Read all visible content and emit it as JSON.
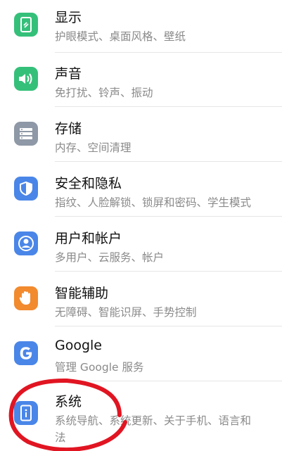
{
  "colors": {
    "green": "#35c07a",
    "gray": "#8e98a6",
    "blue": "#4a86e8",
    "orange": "#f28a2e",
    "annotation_red": "#e11522"
  },
  "settings": {
    "items": [
      {
        "title": "显示",
        "subtitle": "护眼模式、桌面风格、壁纸",
        "icon": "display-icon"
      },
      {
        "title": "声音",
        "subtitle": "免打扰、铃声、振动",
        "icon": "sound-icon"
      },
      {
        "title": "存储",
        "subtitle": "内存、空间清理",
        "icon": "storage-icon"
      },
      {
        "title": "安全和隐私",
        "subtitle": "指纹、人脸解锁、锁屏和密码、学生模式",
        "icon": "security-shield-icon"
      },
      {
        "title": "用户和帐户",
        "subtitle": "多用户、云服务、帐户",
        "icon": "user-account-icon"
      },
      {
        "title": "智能辅助",
        "subtitle": "无障碍、智能识屏、手势控制",
        "icon": "hand-gesture-icon"
      },
      {
        "title": "Google",
        "subtitle": "管理 Google 服务",
        "icon": "google-icon"
      },
      {
        "title": "系统",
        "subtitle": "系统导航、系统更新、关于手机、语言和",
        "subtitle2": "法",
        "icon": "system-phone-icon"
      }
    ]
  },
  "annotation": {
    "type": "red hand-drawn circle around 系统"
  }
}
